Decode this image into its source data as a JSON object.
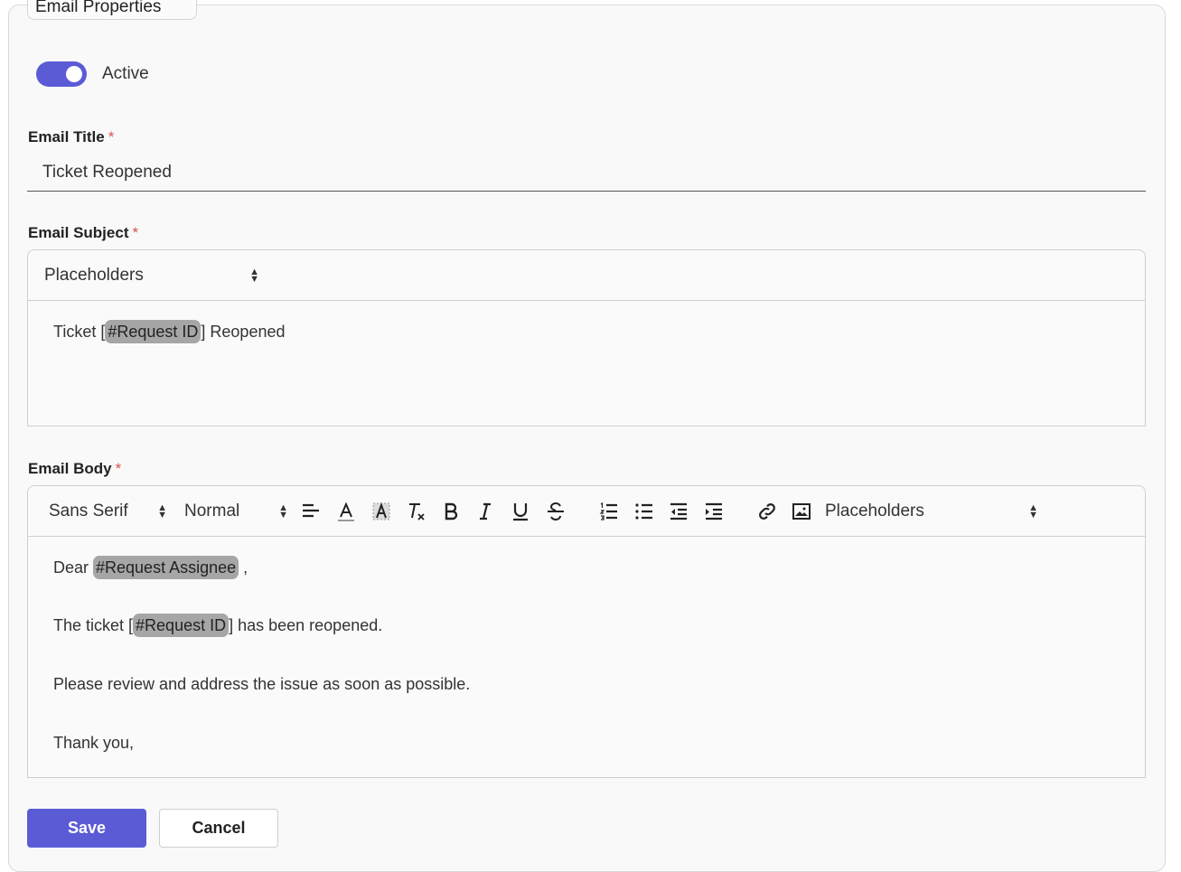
{
  "section": {
    "legend": "Email Properties"
  },
  "active_toggle": {
    "label": "Active",
    "on": true
  },
  "email_title": {
    "label": "Email Title",
    "required_mark": "*",
    "value": "Ticket Reopened"
  },
  "email_subject": {
    "label": "Email Subject",
    "required_mark": "*",
    "placeholder_select": "Placeholders",
    "content": {
      "before": "Ticket [",
      "chip": "#Request ID",
      "after": "] Reopened"
    }
  },
  "email_body": {
    "label": "Email Body",
    "required_mark": "*",
    "toolbar": {
      "font_select": "Sans Serif",
      "size_select": "Normal",
      "placeholder_select": "Placeholders",
      "icons": [
        "align-icon",
        "font-color-icon",
        "background-color-icon",
        "clear-format-icon",
        "bold-icon",
        "italic-icon",
        "underline-icon",
        "strikethrough-icon",
        "ordered-list-icon",
        "bullet-list-icon",
        "outdent-icon",
        "indent-icon",
        "link-icon",
        "image-icon"
      ]
    },
    "lines": {
      "l1": {
        "before": "Dear ",
        "chip": "#Request Assignee",
        "after": " ,"
      },
      "l2": {
        "before": "The ticket [",
        "chip": "#Request ID",
        "after": "] has been reopened."
      },
      "l3": "Please review and address the issue as soon as possible.",
      "l4": "Thank you,"
    }
  },
  "actions": {
    "save": "Save",
    "cancel": "Cancel"
  },
  "colors": {
    "accent": "#5b5bd6",
    "required": "#d9534f",
    "chip": "#a6a6a6"
  }
}
